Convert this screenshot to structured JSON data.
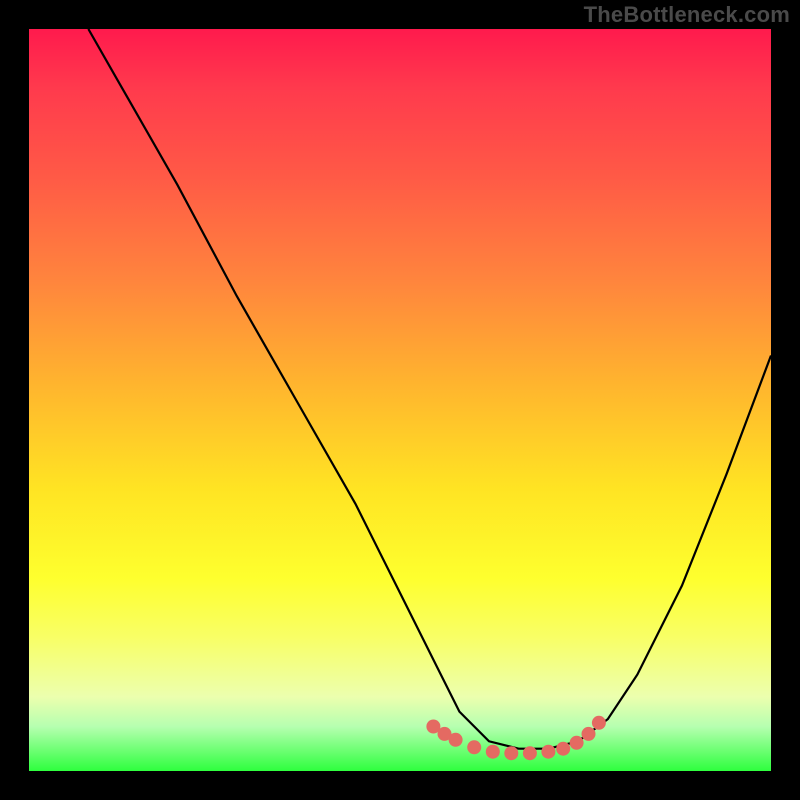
{
  "watermark": "TheBottleneck.com",
  "chart_data": {
    "type": "line",
    "title": "",
    "xlabel": "",
    "ylabel": "",
    "xlim": [
      0,
      1
    ],
    "ylim": [
      0,
      1
    ],
    "series": [
      {
        "name": "curve",
        "color": "#000000",
        "x": [
          0.08,
          0.12,
          0.2,
          0.28,
          0.36,
          0.44,
          0.5,
          0.55,
          0.58,
          0.62,
          0.66,
          0.7,
          0.74,
          0.78,
          0.82,
          0.88,
          0.94,
          1.0
        ],
        "y": [
          1.0,
          0.93,
          0.79,
          0.64,
          0.5,
          0.36,
          0.24,
          0.14,
          0.08,
          0.04,
          0.03,
          0.03,
          0.04,
          0.07,
          0.13,
          0.25,
          0.4,
          0.56
        ]
      }
    ],
    "annotations": [
      {
        "name": "highlight-dots",
        "color": "#e46a62",
        "points": [
          {
            "x": 0.545,
            "y": 0.06
          },
          {
            "x": 0.56,
            "y": 0.05
          },
          {
            "x": 0.575,
            "y": 0.042
          },
          {
            "x": 0.6,
            "y": 0.032
          },
          {
            "x": 0.625,
            "y": 0.026
          },
          {
            "x": 0.65,
            "y": 0.024
          },
          {
            "x": 0.675,
            "y": 0.024
          },
          {
            "x": 0.7,
            "y": 0.026
          },
          {
            "x": 0.72,
            "y": 0.03
          },
          {
            "x": 0.738,
            "y": 0.038
          },
          {
            "x": 0.754,
            "y": 0.05
          },
          {
            "x": 0.768,
            "y": 0.065
          }
        ]
      }
    ]
  }
}
